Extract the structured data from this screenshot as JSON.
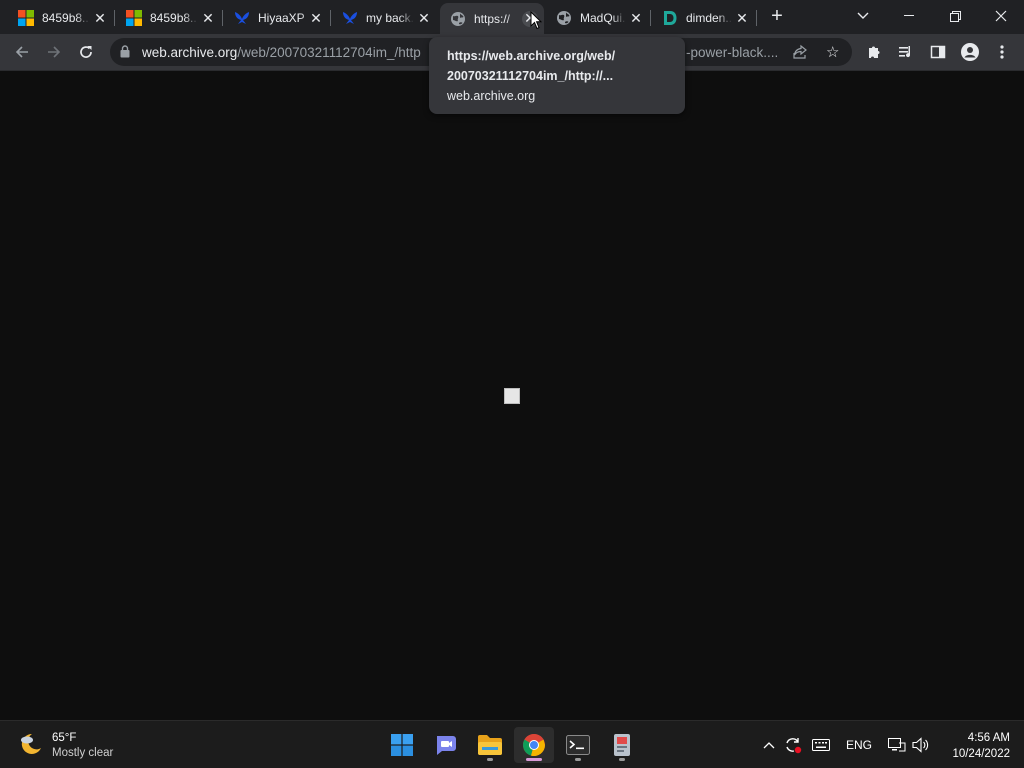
{
  "tabs": [
    {
      "title": "8459b8...",
      "favicon": "microsoft-icon",
      "active": false
    },
    {
      "title": "8459b8...",
      "favicon": "microsoft-icon",
      "active": false
    },
    {
      "title": "HiyaaXP",
      "favicon": "bluesky-icon",
      "active": false
    },
    {
      "title": "my back...",
      "favicon": "bluesky-icon",
      "active": false
    },
    {
      "title": "https://",
      "favicon": "globe-icon",
      "active": true
    },
    {
      "title": "MadQui...",
      "favicon": "globe-icon",
      "active": false
    },
    {
      "title": "dimden...",
      "favicon": "dimden-icon",
      "active": false
    }
  ],
  "omnibox": {
    "host": "web.archive.org",
    "path": "/web/20070321112704im_/http",
    "tail": "-power-black...."
  },
  "hovercard": {
    "line1": "https://web.archive.org/web/",
    "line2": "20070321112704im_/http://...",
    "domain": "web.archive.org"
  },
  "taskbar": {
    "weather_temp": "65°F",
    "weather_condition": "Mostly clear",
    "language": "ENG",
    "time": "4:56 AM",
    "date": "10/24/2022"
  },
  "colors": {
    "accent_active_app": "#d99bd8",
    "page_background": "#0e0e0e"
  }
}
